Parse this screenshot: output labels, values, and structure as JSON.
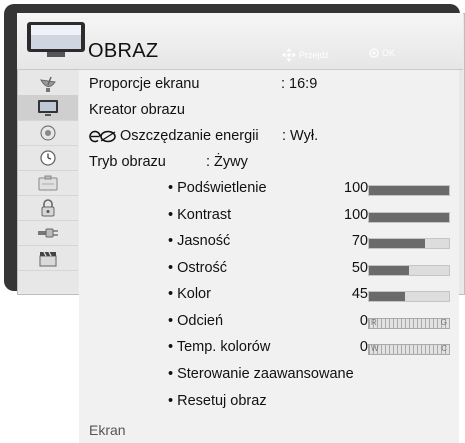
{
  "header": {
    "title": "OBRAZ",
    "hint_move": "Przejdź",
    "hint_ok": "OK"
  },
  "sidebar": {
    "items": [
      {
        "icon": "satellite-dish-icon",
        "active": false
      },
      {
        "icon": "monitor-icon",
        "active": true
      },
      {
        "icon": "speaker-icon",
        "active": false
      },
      {
        "icon": "clock-icon",
        "active": false
      },
      {
        "icon": "options-icon",
        "active": false
      },
      {
        "icon": "lock-icon",
        "active": false
      },
      {
        "icon": "input-plug-icon",
        "active": false
      },
      {
        "icon": "clapperboard-icon",
        "active": false
      }
    ]
  },
  "menu": {
    "aspect_ratio": {
      "label": "Proporcje ekranu",
      "value": ": 16:9"
    },
    "picture_wizard": {
      "label": "Kreator obrazu"
    },
    "energy_saving": {
      "icon": "eco-icon",
      "label": "Oszczędzanie energii",
      "value": ": Wył."
    },
    "picture_mode": {
      "label": "Tryb obrazu",
      "value": ": Żywy"
    },
    "settings": [
      {
        "label": "• Podświetlenie",
        "value": "100",
        "level": 1.0,
        "type": "bar"
      },
      {
        "label": "• Kontrast",
        "value": "100",
        "level": 1.0,
        "type": "bar"
      },
      {
        "label": "• Jasność",
        "value": "70",
        "level": 0.7,
        "type": "bar"
      },
      {
        "label": "• Ostrość",
        "value": "50",
        "level": 0.5,
        "type": "bar"
      },
      {
        "label": "• Kolor",
        "value": "45",
        "level": 0.45,
        "type": "bar"
      },
      {
        "label": "• Odcień",
        "value": "0",
        "type": "balance",
        "left_end": "R",
        "right_end": "G"
      },
      {
        "label": "• Temp. kolorów",
        "value": "0",
        "type": "balance",
        "left_end": "W",
        "right_end": "C"
      }
    ],
    "advanced": {
      "label": "• Sterowanie zaawansowane"
    },
    "reset": {
      "label": "• Resetuj obraz"
    }
  },
  "footer": {
    "label": "Ekran"
  },
  "colors": {
    "bar_fill": "#6a6a6a",
    "bar_bg": "#dddddd",
    "frame": "#353535"
  }
}
